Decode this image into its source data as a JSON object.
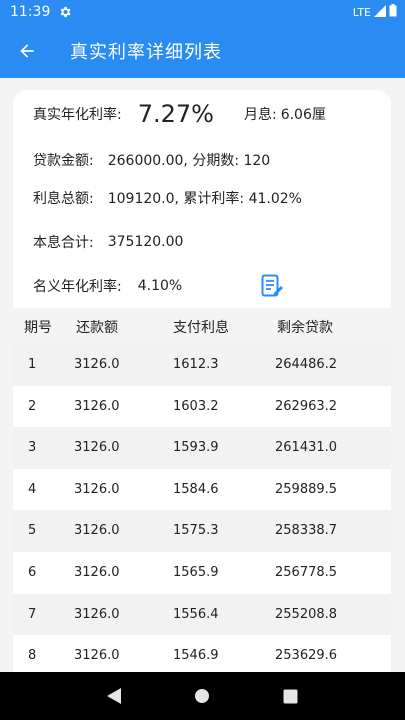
{
  "status_bar": {
    "time": "11:39",
    "network": "LTE"
  },
  "app_bar": {
    "title": "真实利率详细列表"
  },
  "summary": {
    "real_rate_label": "真实年化利率:",
    "real_rate_value": "7.27%",
    "monthly_interest_label": "月息:",
    "monthly_interest_value": "6.06厘",
    "loan_label": "贷款金额:",
    "loan_value": "266000.00, 分期数: 120",
    "interest_total_label": "利息总额:",
    "interest_total_value": "109120.0, 累计利率: 41.02%",
    "principal_total_label": "本息合计:",
    "principal_total_value": "375120.00",
    "nominal_rate_label": "名义年化利率:",
    "nominal_rate_value": "4.10%"
  },
  "table": {
    "headers": [
      "期号",
      "还款额",
      "支付利息",
      "剩余贷款"
    ],
    "rows": [
      [
        "1",
        "3126.0",
        "1612.3",
        "264486.2"
      ],
      [
        "2",
        "3126.0",
        "1603.2",
        "262963.2"
      ],
      [
        "3",
        "3126.0",
        "1593.9",
        "261431.0"
      ],
      [
        "4",
        "3126.0",
        "1584.6",
        "259889.5"
      ],
      [
        "5",
        "3126.0",
        "1575.3",
        "258338.7"
      ],
      [
        "6",
        "3126.0",
        "1565.9",
        "256778.5"
      ],
      [
        "7",
        "3126.0",
        "1556.4",
        "255208.8"
      ],
      [
        "8",
        "3126.0",
        "1546.9",
        "253629.6"
      ]
    ]
  },
  "colors": {
    "primary": "#2a8cf2",
    "row_alt": "#f2f2f2"
  }
}
